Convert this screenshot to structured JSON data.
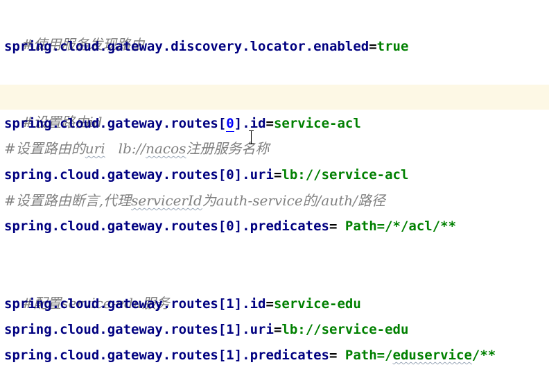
{
  "editor": {
    "lines": [
      {
        "type": "comment",
        "text": "#使用服务发现路由"
      },
      {
        "type": "kv",
        "key": "spring.cloud.gateway.discovery.locator.enabled",
        "sep": "=",
        "value": "true"
      },
      {
        "type": "blank"
      },
      {
        "type": "comment",
        "text": "#设置路由id",
        "current": true
      },
      {
        "type": "kv",
        "key_pre": "spring.cloud.gateway.routes[",
        "key_idx": "0",
        "key_post": "].id",
        "sep": "=",
        "value": "service-acl"
      },
      {
        "type": "comment",
        "text_a": "#设置路由的",
        "text_b": "uri",
        "text_c": "   lb://",
        "text_d": "nacos",
        "text_e": "注册服务名称"
      },
      {
        "type": "kv",
        "key": "spring.cloud.gateway.routes[0].uri",
        "sep": "=",
        "value": "lb://service-acl"
      },
      {
        "type": "comment",
        "text_a": "#设置路由断言,代理",
        "text_b": "servicerId",
        "text_c": "为auth-service的/auth/路径"
      },
      {
        "type": "kv",
        "key": "spring.cloud.gateway.routes[0].predicates",
        "sep": "= ",
        "value": "Path=/*/acl/**"
      },
      {
        "type": "blank"
      },
      {
        "type": "comment",
        "text": "#配置service-edu服务"
      },
      {
        "type": "kv",
        "key": "spring.cloud.gateway.routes[1].id",
        "sep": "=",
        "value": "service-edu"
      },
      {
        "type": "kv",
        "key": "spring.cloud.gateway.routes[1].uri",
        "sep": "=",
        "value": "lb://service-edu"
      },
      {
        "type": "kv",
        "key": "spring.cloud.gateway.routes[1].predicates",
        "sep": "= ",
        "value_a": "Path=/",
        "value_b": "eduservice",
        "value_c": "/**"
      }
    ]
  }
}
